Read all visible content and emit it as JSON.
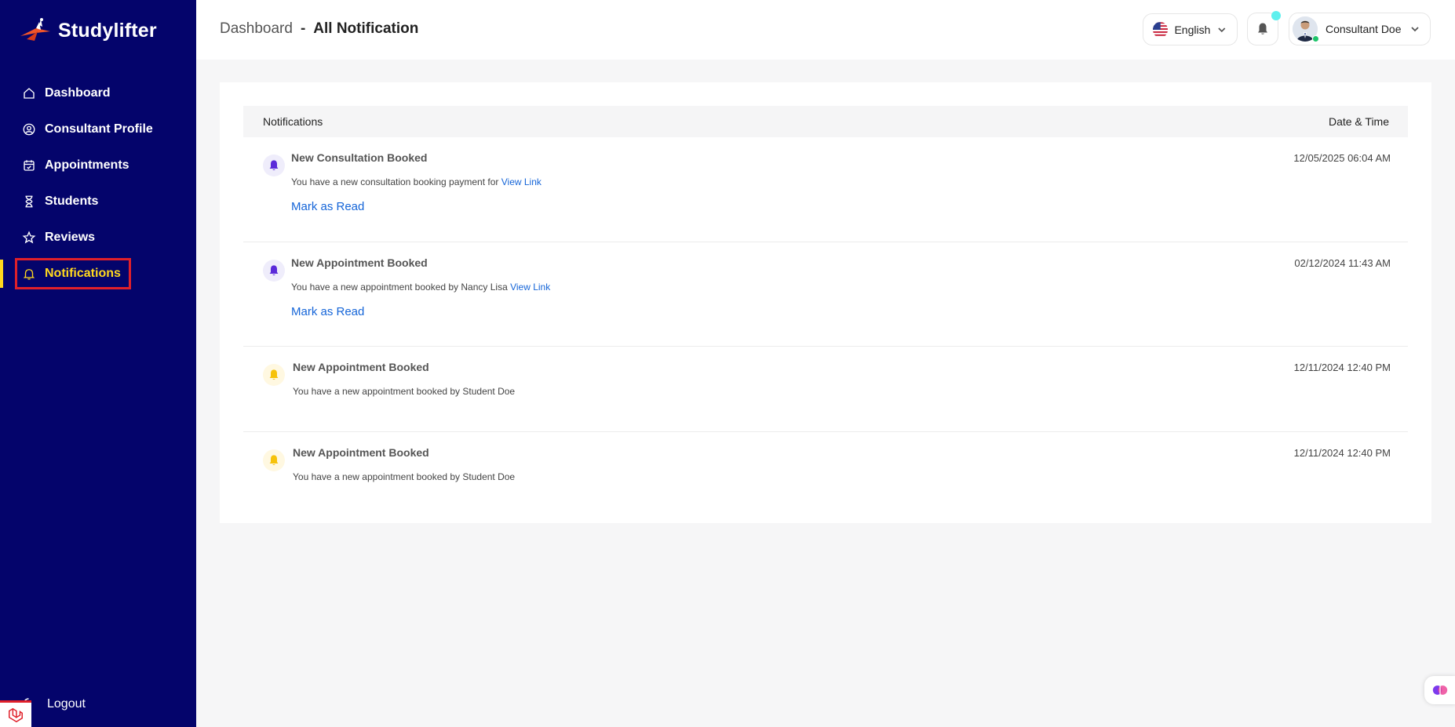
{
  "brand": {
    "name": "Studylifter"
  },
  "sidebar": {
    "items": [
      {
        "label": "Dashboard",
        "icon": "home-icon"
      },
      {
        "label": "Consultant Profile",
        "icon": "user-circle-icon"
      },
      {
        "label": "Appointments",
        "icon": "calendar-icon"
      },
      {
        "label": "Students",
        "icon": "hourglass-icon"
      },
      {
        "label": "Reviews",
        "icon": "star-icon"
      },
      {
        "label": "Notifications",
        "icon": "bell-icon",
        "active": true
      }
    ],
    "logout_label": "Logout"
  },
  "header": {
    "breadcrumb_root": "Dashboard",
    "breadcrumb_sep": "-",
    "breadcrumb_current": "All Notification",
    "language": "English",
    "user_name": "Consultant Doe"
  },
  "notifications": {
    "col_notifications": "Notifications",
    "col_datetime": "Date & Time",
    "rows": [
      {
        "title": "New Consultation Booked",
        "message": "You have a new consultation booking payment for ",
        "link": "View Link",
        "action": "Mark as Read",
        "datetime": "12/05/2025 06:04 AM",
        "icon_color": "#5b2bd9"
      },
      {
        "title": "New Appointment Booked",
        "message": "You have a new appointment booked by Nancy Lisa ",
        "link": "View Link",
        "action": "Mark as Read",
        "datetime": "02/12/2024 11:43 AM",
        "icon_color": "#5b2bd9"
      },
      {
        "title": "New Appointment Booked",
        "message": "You have a new appointment booked by Student Doe",
        "datetime": "12/11/2024 12:40 PM",
        "icon_color": "#f6c20a"
      },
      {
        "title": "New Appointment Booked",
        "message": "You have a new appointment booked by Student Doe",
        "datetime": "12/11/2024 12:40 PM",
        "icon_color": "#f6c20a"
      }
    ]
  },
  "colors": {
    "sidebar_bg": "#04046b",
    "active_nav": "#ffd81e",
    "link": "#1565d8",
    "highlight_box": "#e0202a"
  }
}
